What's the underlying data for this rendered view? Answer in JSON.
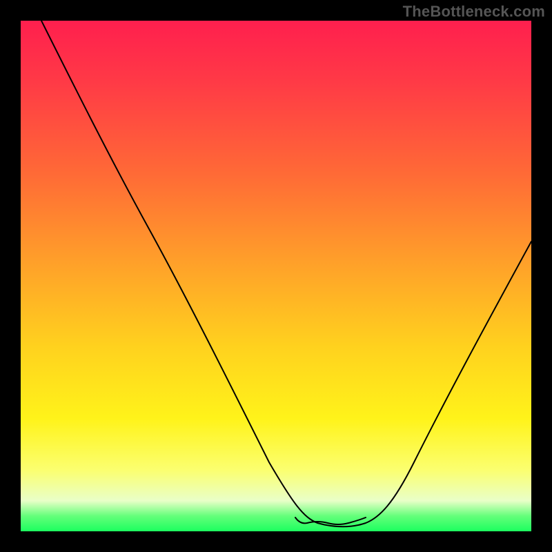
{
  "watermark": "TheBottleneck.com",
  "colors": {
    "frame_bg": "#000000",
    "gradient_top": "#ff1f4e",
    "gradient_mid1": "#ff6a36",
    "gradient_mid2": "#ffd21e",
    "gradient_mid3": "#fbff70",
    "gradient_bottom": "#1cff5f",
    "curve_stroke": "#000000",
    "valley_marker": "#d85a5a"
  },
  "chart_data": {
    "type": "line",
    "title": "",
    "xlabel": "",
    "ylabel": "",
    "x": [
      0.0,
      0.05,
      0.1,
      0.15,
      0.2,
      0.25,
      0.3,
      0.35,
      0.4,
      0.45,
      0.5,
      0.55,
      0.6,
      0.65,
      0.7,
      0.75,
      0.8,
      0.85,
      0.9,
      0.95,
      1.0
    ],
    "y": [
      1.0,
      0.9,
      0.8,
      0.7,
      0.6,
      0.5,
      0.4,
      0.3,
      0.2,
      0.1,
      0.04,
      0.01,
      0.0,
      0.0,
      0.02,
      0.08,
      0.18,
      0.3,
      0.42,
      0.52,
      0.6
    ],
    "series_notes": "y is normalized bottleneck intensity 0..1 (0 = optimal, 1 = worst); valley around x≈0.55–0.68",
    "valley_region_x": [
      0.53,
      0.68
    ],
    "xlim": [
      0,
      1
    ],
    "ylim": [
      0,
      1
    ],
    "grid": false,
    "legend": false
  }
}
